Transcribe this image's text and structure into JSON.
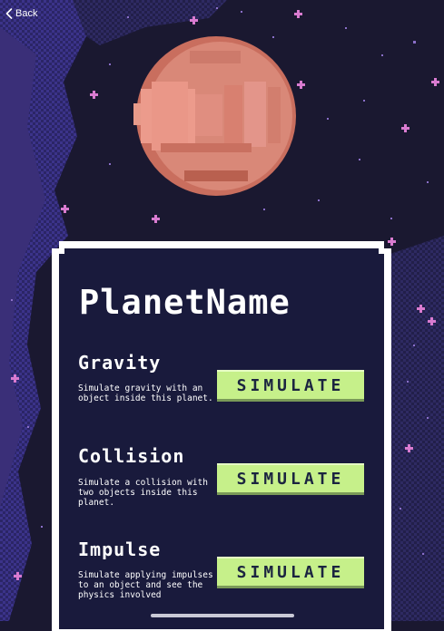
{
  "nav": {
    "back_label": "Back"
  },
  "planet": {
    "name": "PlanetName"
  },
  "sections": [
    {
      "title": "Gravity",
      "description": "Simulate gravity with an object inside this planet.",
      "button_label": "SIMULATE"
    },
    {
      "title": "Collision",
      "description": "Simulate a collision with two objects inside this planet.",
      "button_label": "SIMULATE"
    },
    {
      "title": "Impulse",
      "description": "Simulate applying impulses to an object and see the physics involved",
      "button_label": "SIMULATE"
    }
  ],
  "colors": {
    "space_bg": "#1a1830",
    "nebula": "#3a2f78",
    "card_bg": "#191a3c",
    "card_border": "#ffffff",
    "button_bg": "#c6f08a",
    "button_text": "#1b2440",
    "planet": "#d98878",
    "star": "#e07bd8"
  },
  "icons": {
    "back": "chevron-left-icon",
    "star": "sparkle-icon"
  }
}
